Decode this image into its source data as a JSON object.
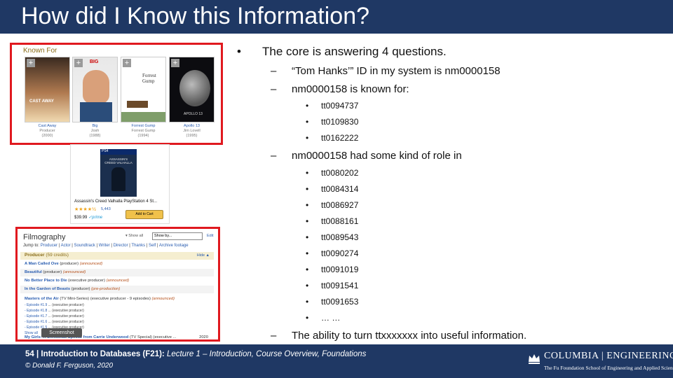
{
  "slide": {
    "title": "How did I Know this Information?"
  },
  "known_for": {
    "header": "Known For",
    "posters": [
      {
        "title": "Cast Away",
        "role": "Producer",
        "year": "(2000)",
        "poster_text": "CAST AWAY"
      },
      {
        "title": "Big",
        "role": "Josh",
        "year": "(1988)",
        "poster_text": "BIG"
      },
      {
        "title": "Forrest Gump",
        "role": "Forrest Gump",
        "year": "(1994)",
        "poster_text": "Forrest Gump"
      },
      {
        "title": "Apollo 13",
        "role": "Jim Lovell",
        "year": "(1995)",
        "poster_text": "APOLLO 13"
      }
    ]
  },
  "ad": {
    "platform": "PS4",
    "cover_text": "ASSASSIN'S CREED VALHALLA",
    "title": "Assassin's Creed Valhalla PlayStation 4 St...",
    "stars": "★★★★½",
    "rating_count": "5,443",
    "price": "$39.99",
    "prime": "✓prime",
    "cart_label": "Add to Cart"
  },
  "filmography": {
    "header": "Filmography",
    "show_all": "▾ Show all",
    "select": "Show by...",
    "edit": "Edit",
    "jump_label": "Jump to:",
    "jump_links": [
      "Producer",
      "Actor",
      "Soundtrack",
      "Writer",
      "Director",
      "Thanks",
      "Self",
      "Archive footage"
    ],
    "section_label": "Producer",
    "section_count": "(59 credits)",
    "hide": "Hide ▲",
    "rows": [
      {
        "title": "A Man Called Ove",
        "role": " (producer) ",
        "status": "(announced)"
      },
      {
        "title": "Beautiful",
        "role": " (producer) ",
        "status": "(announced)"
      },
      {
        "title": "No Better Place to Die",
        "role": " (executive producer) ",
        "status": "(announced)"
      },
      {
        "title": "In the Garden of Beasts",
        "role": " (producer) ",
        "status": "(pre-production)"
      },
      {
        "title": "Masters of the Air",
        "role": " (TV Mini-Series) (executive producer - 9 episodes) ",
        "status": "(announced)"
      }
    ],
    "episodes": [
      {
        "ep": "- Episode #1.9",
        "role": " ... (executive producer)"
      },
      {
        "ep": "- Episode #1.8",
        "role": " ... (executive producer)"
      },
      {
        "ep": "- Episode #1.7",
        "role": " ... (executive producer)"
      },
      {
        "ep": "- Episode #1.6",
        "role": " ... (executive producer)"
      },
      {
        "ep": "- Episode #1.5",
        "role": " ... (executive producer)"
      }
    ],
    "show_all_eps": "Show all",
    "last_row_title": "My Girls: A Christmas Special from Carrie Underwood",
    "last_row_role": " (TV Special) (executive ...",
    "last_row_year": "2020",
    "tooltip": "Screenshot"
  },
  "content": {
    "b1": "The core is answering 4 questions.",
    "b2a": "“Tom Hanks’” ID in my system is nm0000158",
    "b2b": "nm0000158 is known for:",
    "known_ids": [
      "tt0094737",
      "tt0109830",
      "tt0162222"
    ],
    "b2c": "nm0000158 had some kind of role in",
    "role_ids": [
      "tt0080202",
      "tt0084314",
      "tt0086927",
      "tt0088161",
      "tt0089543",
      "tt0090274",
      "tt0091019",
      "tt0091541",
      "tt0091653",
      "… …"
    ],
    "b2d": "The ability to turn ttxxxxxxx into useful information."
  },
  "footer": {
    "line1_bold": "54 | Introduction to Databases (F21):",
    "line1_rest": " Lecture 1 – Introduction, Course Overview, Foundations",
    "line2": "© Donald F. Ferguson, 2020",
    "logo_brand": "COLUMBIA | ENGINEERING",
    "logo_sub": "The Fu Foundation School of Engineering and Applied Science"
  },
  "colors": {
    "title_bar": "#1f3864",
    "highlight": "#e0191f",
    "link": "#2a5db0"
  }
}
